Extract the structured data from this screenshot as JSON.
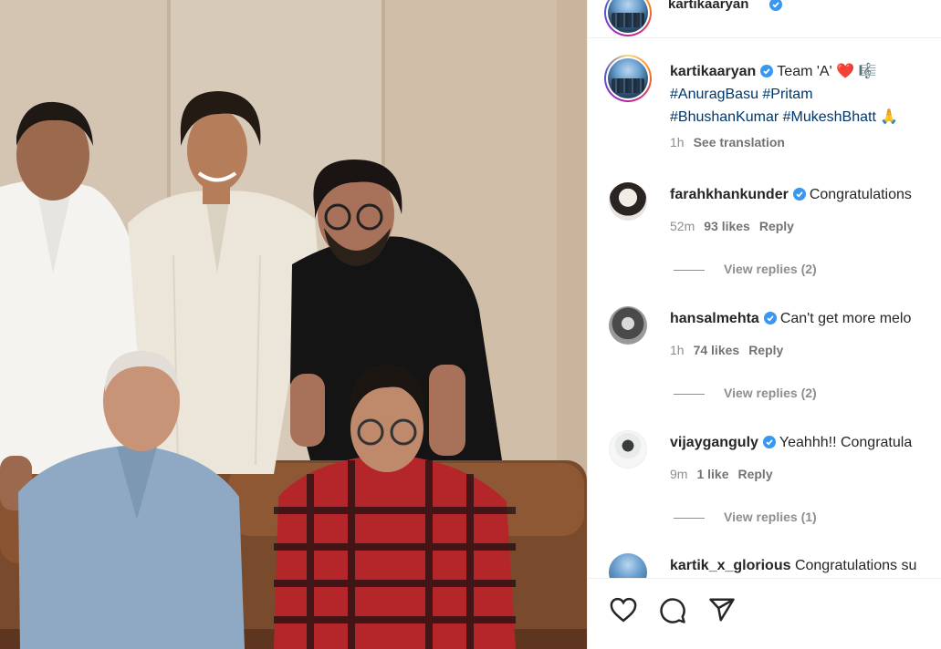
{
  "post": {
    "author": "kartikaaryan",
    "caption_text": "Team 'A' ❤️ 🎼",
    "hashtags_line1": "#AnuragBasu #Pritam",
    "hashtags_line2": "#BhushanKumar #MukeshBhatt 🙏",
    "time": "1h",
    "see_translation": "See translation"
  },
  "comments": [
    {
      "user": "farahkhankunder",
      "text": "Congratulations",
      "time": "52m",
      "likes": "93 likes",
      "reply": "Reply",
      "view_replies": "View replies (2)"
    },
    {
      "user": "hansalmehta",
      "text": "Can't get more melo",
      "time": "1h",
      "likes": "74 likes",
      "reply": "Reply",
      "view_replies": "View replies (2)"
    },
    {
      "user": "vijayganguly",
      "text": "Yeahhh!! Congratula",
      "time": "9m",
      "likes": "1 like",
      "reply": "Reply",
      "view_replies": "View replies (1)"
    },
    {
      "user": "kartik_x_glorious",
      "text": "Congratulations su"
    }
  ],
  "icons": {
    "like": "heart-icon",
    "comment": "comment-icon",
    "share": "share-icon",
    "verified": "verified-badge-icon"
  },
  "colors": {
    "verified": "#3897f0",
    "hashtag": "#00376b",
    "muted": "#8e8e8e"
  }
}
